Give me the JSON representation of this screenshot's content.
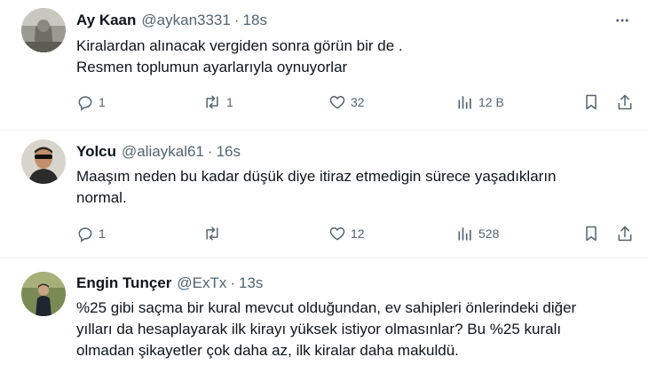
{
  "tweets": [
    {
      "display_name": "Ay Kaan",
      "handle": "@aykan3331",
      "separator": "·",
      "time": "18s",
      "text_lines": [
        "Kiralardan alınacak vergiden sonra görün bir de .",
        "Resmen toplumun ayarlarıyla oynuyorlar"
      ],
      "replies": "1",
      "retweets": "1",
      "likes": "32",
      "views": "12 B"
    },
    {
      "display_name": "Yolcu",
      "handle": "@aliaykal61",
      "separator": "·",
      "time": "16s",
      "text_lines": [
        "Maaşım neden bu kadar düşük diye itiraz etmedigin sürece yaşadıkların",
        "normal."
      ],
      "replies": "1",
      "retweets": "",
      "likes": "12",
      "views": "528"
    },
    {
      "display_name": "Engin Tunçer",
      "handle": "@ExTx",
      "separator": "·",
      "time": "13s",
      "text_lines": [
        "%25 gibi saçma bir kural mevcut olduğundan, ev sahipleri önlerindeki diğer",
        "yılları da hesaplayarak ilk kirayı yüksek istiyor olmasınlar? Bu %25 kuralı",
        "olmadan şikayetler çok daha az, ilk kiralar daha makuldü."
      ]
    }
  ],
  "icons": {
    "reply": "reply-icon",
    "retweet": "retweet-icon",
    "like": "heart-icon",
    "views": "views-chart-icon",
    "bookmark": "bookmark-icon",
    "share": "share-icon",
    "more": "more-options-icon"
  },
  "colors": {
    "text": "#0f1419",
    "secondary": "#536471",
    "divider": "#eff3f4"
  }
}
